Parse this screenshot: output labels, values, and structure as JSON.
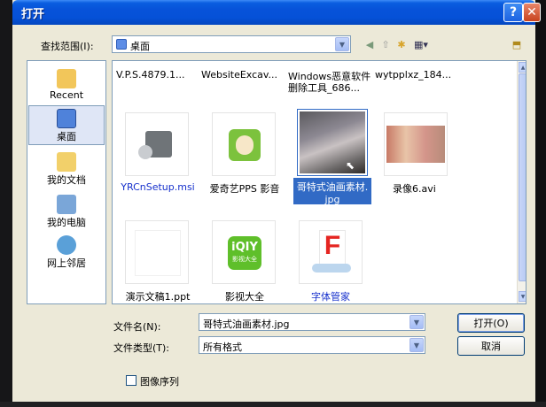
{
  "window": {
    "title": "打开",
    "help_label": "?",
    "close_label": "✕"
  },
  "lookin": {
    "label": "查找范围(I):",
    "value": "桌面"
  },
  "places": [
    {
      "label": "Recent",
      "icon": "recent-folder-icon"
    },
    {
      "label": "桌面",
      "icon": "desktop-icon"
    },
    {
      "label": "我的文档",
      "icon": "my-documents-icon"
    },
    {
      "label": "我的电脑",
      "icon": "my-computer-icon"
    },
    {
      "label": "网上邻居",
      "icon": "network-icon"
    }
  ],
  "files": {
    "top_row": [
      "V.P.S.4879.1...",
      "WebsiteExcav...",
      "Windows恶意软件",
      "删除工具_686...",
      "wytpplxz_184..."
    ],
    "row2": [
      {
        "name": "YRCnSetup.msi",
        "icon": "installer-icon",
        "blue": true
      },
      {
        "name": "爱奇艺PPS 影音",
        "icon": "pps-app-icon",
        "blue": false
      },
      {
        "name": "哥特式油画素材.",
        "name2": "jpg",
        "icon": "image-thumbnail",
        "blue": false
      },
      {
        "name": "录像6.avi",
        "icon": "video-thumbnail",
        "blue": false
      }
    ],
    "row3": [
      {
        "name": "演示文稿1.ppt",
        "icon": "ppt-icon",
        "blue": false
      },
      {
        "name": "影视大全",
        "icon": "iqiyi-icon",
        "badge": "iQIY",
        "sub": "影视大全",
        "blue": false
      },
      {
        "name": "字体管家",
        "icon": "font-manager-icon",
        "badge": "F",
        "blue": true
      }
    ]
  },
  "filename": {
    "label": "文件名(N):",
    "value": "哥特式油画素材.jpg"
  },
  "filetype": {
    "label": "文件类型(T):",
    "value": "所有格式"
  },
  "buttons": {
    "open": "打开(O)",
    "cancel": "取消"
  },
  "sequence": {
    "label": "图像序列"
  },
  "colors": {
    "title_blue": "#0551d8",
    "selection": "#316ac5",
    "iqiyi_green": "#5fbf2a",
    "font_red": "#e52521"
  }
}
